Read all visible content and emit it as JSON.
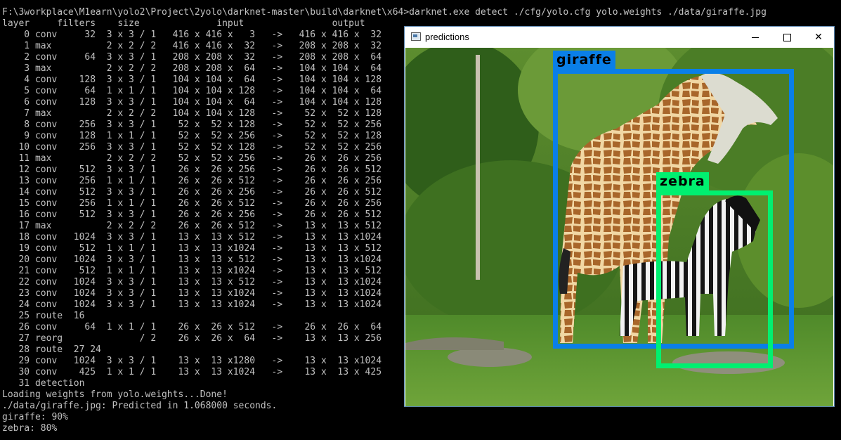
{
  "console": {
    "command": "F:\\3workplace\\M1earn\\yolo2\\Project\\2yolo\\darknet-master\\build\\darknet\\x64>darknet.exe detect ./cfg/yolo.cfg yolo.weights ./data/giraffe.jpg",
    "header": "layer     filters    size              input                output",
    "layers": [
      "    0 conv     32  3 x 3 / 1   416 x 416 x   3   ->   416 x 416 x  32",
      "    1 max          2 x 2 / 2   416 x 416 x  32   ->   208 x 208 x  32",
      "    2 conv     64  3 x 3 / 1   208 x 208 x  32   ->   208 x 208 x  64",
      "    3 max          2 x 2 / 2   208 x 208 x  64   ->   104 x 104 x  64",
      "    4 conv    128  3 x 3 / 1   104 x 104 x  64   ->   104 x 104 x 128",
      "    5 conv     64  1 x 1 / 1   104 x 104 x 128   ->   104 x 104 x  64",
      "    6 conv    128  3 x 3 / 1   104 x 104 x  64   ->   104 x 104 x 128",
      "    7 max          2 x 2 / 2   104 x 104 x 128   ->    52 x  52 x 128",
      "    8 conv    256  3 x 3 / 1    52 x  52 x 128   ->    52 x  52 x 256",
      "    9 conv    128  1 x 1 / 1    52 x  52 x 256   ->    52 x  52 x 128",
      "   10 conv    256  3 x 3 / 1    52 x  52 x 128   ->    52 x  52 x 256",
      "   11 max          2 x 2 / 2    52 x  52 x 256   ->    26 x  26 x 256",
      "   12 conv    512  3 x 3 / 1    26 x  26 x 256   ->    26 x  26 x 512",
      "   13 conv    256  1 x 1 / 1    26 x  26 x 512   ->    26 x  26 x 256",
      "   14 conv    512  3 x 3 / 1    26 x  26 x 256   ->    26 x  26 x 512",
      "   15 conv    256  1 x 1 / 1    26 x  26 x 512   ->    26 x  26 x 256",
      "   16 conv    512  3 x 3 / 1    26 x  26 x 256   ->    26 x  26 x 512",
      "   17 max          2 x 2 / 2    26 x  26 x 512   ->    13 x  13 x 512",
      "   18 conv   1024  3 x 3 / 1    13 x  13 x 512   ->    13 x  13 x1024",
      "   19 conv    512  1 x 1 / 1    13 x  13 x1024   ->    13 x  13 x 512",
      "   20 conv   1024  3 x 3 / 1    13 x  13 x 512   ->    13 x  13 x1024",
      "   21 conv    512  1 x 1 / 1    13 x  13 x1024   ->    13 x  13 x 512",
      "   22 conv   1024  3 x 3 / 1    13 x  13 x 512   ->    13 x  13 x1024",
      "   23 conv   1024  3 x 3 / 1    13 x  13 x1024   ->    13 x  13 x1024",
      "   24 conv   1024  3 x 3 / 1    13 x  13 x1024   ->    13 x  13 x1024",
      "   25 route  16",
      "   26 conv     64  1 x 1 / 1    26 x  26 x 512   ->    26 x  26 x  64",
      "   27 reorg              / 2    26 x  26 x  64   ->    13 x  13 x 256",
      "   28 route  27 24",
      "   29 conv   1024  3 x 3 / 1    13 x  13 x1280   ->    13 x  13 x1024",
      "   30 conv    425  1 x 1 / 1    13 x  13 x1024   ->    13 x  13 x 425",
      "   31 detection"
    ],
    "footer": [
      "Loading weights from yolo.weights...Done!",
      "./data/giraffe.jpg: Predicted in 1.068000 seconds.",
      "giraffe: 90%",
      "zebra: 80%"
    ]
  },
  "window": {
    "title": "predictions",
    "icons": {
      "app": "image-window-icon",
      "minimize": "minimize-icon",
      "maximize": "maximize-icon",
      "close": "close-icon"
    },
    "close_glyph": "✕"
  },
  "detections": [
    {
      "label": "giraffe",
      "confidence": "90%",
      "color": "#0a7fe8"
    },
    {
      "label": "zebra",
      "confidence": "80%",
      "color": "#00f070"
    }
  ],
  "colors": {
    "console_bg": "#000000",
    "console_text": "#c0c0c0",
    "titlebar": "#ffffff"
  }
}
